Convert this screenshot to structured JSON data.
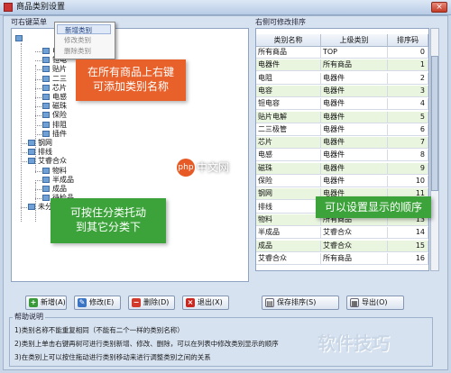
{
  "window": {
    "title": "商品类别设置",
    "close_glyph": "×"
  },
  "left_panel": {
    "label": "可右键菜单"
  },
  "context_menu": {
    "items": [
      "新增类别",
      "修改类别",
      "删除类别"
    ]
  },
  "tree": {
    "items": [
      {
        "label": "电器件",
        "level": 2
      },
      {
        "label": "钽电",
        "level": 2
      },
      {
        "label": "贴片",
        "level": 2
      },
      {
        "label": "二三",
        "level": 2
      },
      {
        "label": "芯片",
        "level": 2
      },
      {
        "label": "电感",
        "level": 2
      },
      {
        "label": "磁珠",
        "level": 2
      },
      {
        "label": "保险",
        "level": 2
      },
      {
        "label": "排阻",
        "level": 2
      },
      {
        "label": "插件",
        "level": 2
      },
      {
        "label": "钢网",
        "level": 1
      },
      {
        "label": "排线",
        "level": 1
      },
      {
        "label": "艾睿合众",
        "level": 1
      },
      {
        "label": "物料",
        "level": 2
      },
      {
        "label": "半成品",
        "level": 2
      },
      {
        "label": "成品",
        "level": 2
      },
      {
        "label": "待检品",
        "level": 2
      },
      {
        "label": "未分类",
        "level": 1
      }
    ]
  },
  "grid": {
    "label": "右侧可修改排序",
    "columns": [
      "类别名称",
      "上级类别",
      "排序码"
    ],
    "rows": [
      [
        "所有商品",
        "TOP",
        "0"
      ],
      [
        "电器件",
        "所有商品",
        "1"
      ],
      [
        "电阻",
        "电器件",
        "2"
      ],
      [
        "电容",
        "电器件",
        "3"
      ],
      [
        "钽电容",
        "电器件",
        "4"
      ],
      [
        "贴片电解",
        "电器件",
        "5"
      ],
      [
        "二三极管",
        "电器件",
        "6"
      ],
      [
        "芯片",
        "电器件",
        "7"
      ],
      [
        "电感",
        "电器件",
        "8"
      ],
      [
        "磁珠",
        "电器件",
        "9"
      ],
      [
        "保险",
        "电器件",
        "10"
      ],
      [
        "钢网",
        "电器件",
        "11"
      ],
      [
        "排线",
        "电器件",
        "12"
      ],
      [
        "物料",
        "所有商品",
        "13"
      ],
      [
        "半成品",
        "艾睿合众",
        "14"
      ],
      [
        "成品",
        "艾睿合众",
        "15"
      ],
      [
        "艾睿合众",
        "所有商品",
        "16"
      ]
    ]
  },
  "buttons": {
    "add": "新增(A)",
    "edit": "修改(E)",
    "delete": "删除(D)",
    "exit": "退出(X)",
    "save_sort": "保存排序(S)",
    "export": "导出(O)"
  },
  "help": {
    "title": "帮助说明",
    "lines": [
      "1)类别名称不能重复相同（不能有二个一样的类别名称）",
      "2)类别上单击右键再树可进行类别新增、修改、删除，可以在列表中修改类别显示的顺序",
      "3)在类别上可以按住拖动进行类别移动来进行调整类别之间的关系"
    ]
  },
  "callouts": {
    "orange": [
      "在所有商品上右键",
      "可添加类别名称"
    ],
    "green_left": [
      "可按住分类托动",
      "到其它分类下"
    ],
    "green_right": "可以设置显示的顺序"
  },
  "watermark": {
    "logo": "php",
    "site": "中文网",
    "brand": "软件技巧"
  },
  "colors": {
    "accent_green": "#3ca33a",
    "accent_orange": "#e8612a",
    "row_alt": "#e9f5df"
  }
}
